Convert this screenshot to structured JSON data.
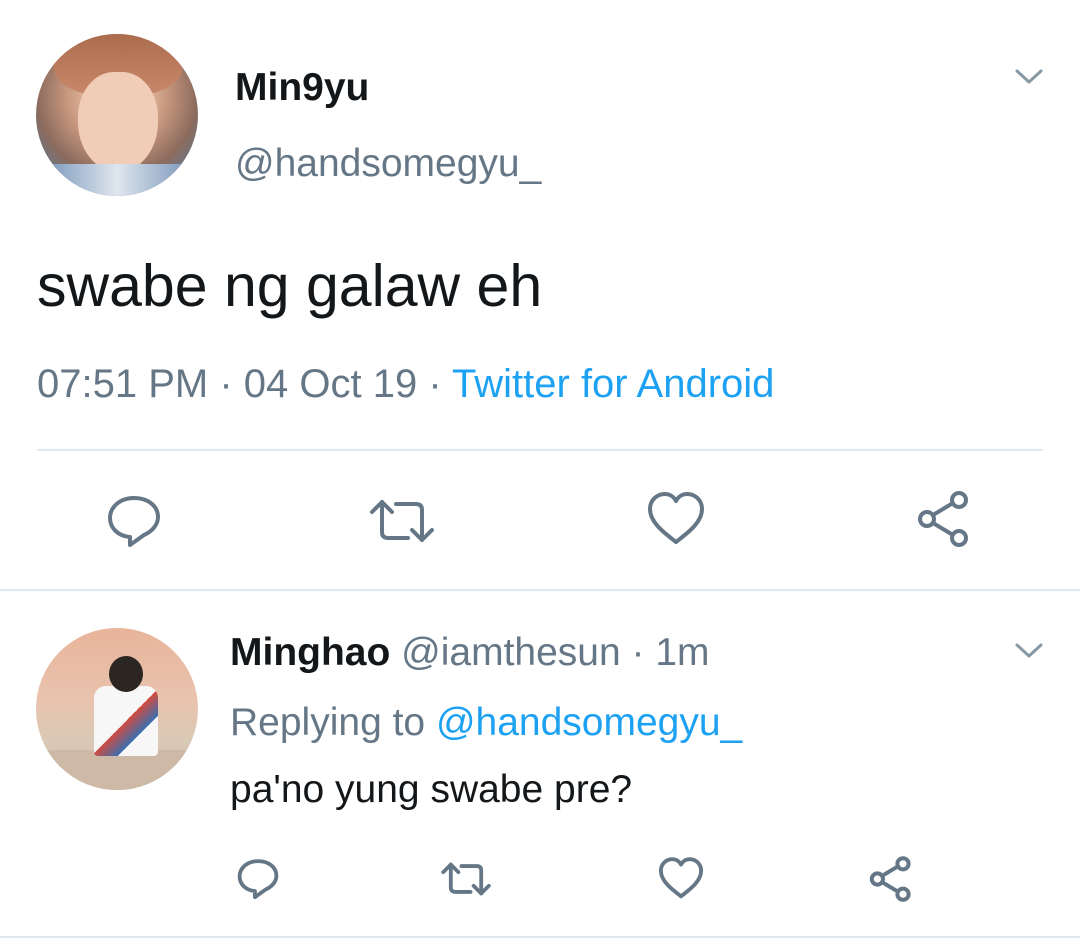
{
  "main_tweet": {
    "display_name": "Min9yu",
    "handle": "@handsomegyu_",
    "text": "swabe ng galaw eh",
    "time": "07:51 PM",
    "date": "04 Oct 19",
    "source": "Twitter for Android",
    "separator": " · ",
    "actions": [
      "reply-icon",
      "retweet-icon",
      "like-icon",
      "share-icon"
    ]
  },
  "reply_tweet": {
    "display_name": "Minghao",
    "handle": "@iamthesun",
    "time_ago": "1m",
    "separator": " · ",
    "replying_prefix": "Replying to ",
    "replying_to": "@handsomegyu_",
    "text": "pa'no yung swabe pre?",
    "actions": [
      "reply-icon",
      "retweet-icon",
      "like-icon",
      "share-icon"
    ]
  },
  "colors": {
    "text_primary": "#14171a",
    "text_secondary": "#657786",
    "accent": "#1da1f2",
    "icon": "#657786",
    "divider": "#e1e8ed"
  }
}
